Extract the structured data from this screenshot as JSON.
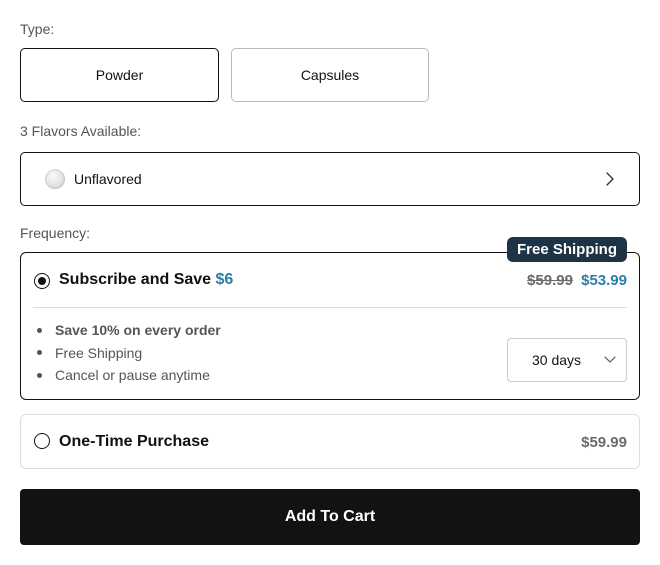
{
  "type_section": {
    "label": "Type:",
    "options": [
      {
        "label": "Powder",
        "selected": true
      },
      {
        "label": "Capsules",
        "selected": false
      }
    ]
  },
  "flavor_section": {
    "label": "3 Flavors Available:",
    "selected": "Unflavored",
    "icon": "chevron-right-icon"
  },
  "frequency_section": {
    "label": "Frequency:",
    "subscribe": {
      "badge": "Free Shipping",
      "title": "Subscribe and Save",
      "savings": "$6",
      "original_price": "$59.99",
      "price": "$53.99",
      "selected": true,
      "benefits": [
        "Save 10% on every order",
        "Free Shipping",
        "Cancel or pause anytime"
      ],
      "interval": "30 days"
    },
    "one_time": {
      "title": "One-Time Purchase",
      "price": "$59.99",
      "selected": false
    }
  },
  "cart": {
    "button_label": "Add To Cart"
  },
  "colors": {
    "accent": "#2a7fa8",
    "badge_bg": "#1e3346",
    "button_bg": "#121212"
  }
}
